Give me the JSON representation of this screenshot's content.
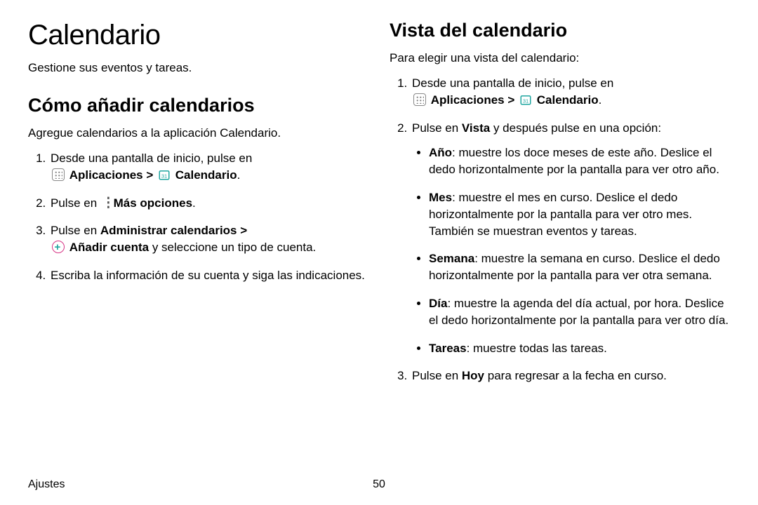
{
  "left": {
    "title": "Calendario",
    "intro": "Gestione sus eventos y tareas.",
    "h2": "Cómo añadir calendarios",
    "lead": "Agregue calendarios a la aplicación Calendario.",
    "step1_a": "Desde una pantalla de inicio, pulse en ",
    "step1_apps": "Aplicaciones",
    "step1_cal": "Calendario",
    "step2_a": "Pulse en ",
    "step2_b": "Más opciones",
    "step3_a": "Pulse en ",
    "step3_b": "Administrar calendarios",
    "step3_c": "Añadir cuenta",
    "step3_d": " y seleccione un tipo de cuenta.",
    "step4": "Escriba la información de su cuenta y siga las indicaciones."
  },
  "right": {
    "h2": "Vista del calendario",
    "lead": "Para elegir una vista del calendario:",
    "step1_a": "Desde una pantalla de inicio, pulse en ",
    "step1_apps": "Aplicaciones",
    "step1_cal": "Calendario",
    "step2_a": "Pulse en ",
    "step2_b": "Vista",
    "step2_c": " y después pulse en una opción:",
    "b_year_t": "Año",
    "b_year_d": ": muestre los doce meses de este año. Deslice el dedo horizontalmente por la pantalla para ver otro año.",
    "b_month_t": "Mes",
    "b_month_d": ": muestre el mes en curso. Deslice el dedo horizontalmente por la pantalla para ver otro mes. También se muestran eventos y tareas.",
    "b_week_t": "Semana",
    "b_week_d": ": muestre la semana en curso. Deslice el dedo horizontalmente por la pantalla para ver otra semana.",
    "b_day_t": "Día",
    "b_day_d": ": muestre la agenda del día actual, por hora. Deslice el dedo horizontalmente por la pantalla para ver otro día.",
    "b_tasks_t": "Tareas",
    "b_tasks_d": ": muestre todas las tareas.",
    "step3_a": "Pulse en ",
    "step3_b": "Hoy",
    "step3_c": " para regresar a la fecha en curso."
  },
  "footer": {
    "section": "Ajustes",
    "page": "50"
  },
  "glyphs": {
    "chevron": ">",
    "period": "."
  }
}
